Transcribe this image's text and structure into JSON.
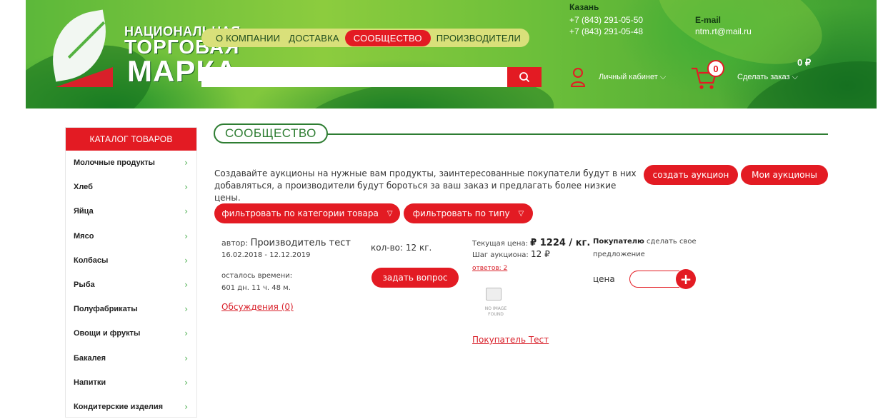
{
  "header": {
    "logo": {
      "line1": "НАЦИОНАЛЬНАЯ",
      "line2": "ТОРГОВАЯ",
      "line3": "МАРКА"
    },
    "nav": [
      "О КОМПАНИИ",
      "ДОСТАВКА",
      "СООБЩЕСТВО",
      "ПРОИЗВОДИТЕЛИ"
    ],
    "nav_active": "СООБЩЕСТВО",
    "search_placeholder": "",
    "city": "Казань",
    "phones": [
      "+7 (843) 291-05-50",
      "+7 (843) 291-05-48"
    ],
    "email_label": "E-mail",
    "email": "ntm.rt@mail.ru",
    "cabinet_label": "Личный кабинет",
    "cart_count": "0",
    "cart_sum": "0 ₽",
    "order_label": "Сделать заказ"
  },
  "sidebar": {
    "title": "КАТАЛОГ ТОВАРОВ",
    "items": [
      "Молочные продукты",
      "Хлеб",
      "Яйца",
      "Мясо",
      "Колбасы",
      "Рыба",
      "Полуфабрикаты",
      "Овощи и фрукты",
      "Бакалея",
      "Напитки",
      "Кондитерские изделия"
    ]
  },
  "main": {
    "title": "СООБЩЕСТВО",
    "description": "Создавайте аукционы на нужные вам продукты, заинтересованные покупатели будут в них добавляться, а производители будут бороться за ваш заказ и предлагать более низкие цены.",
    "create_auction": "создать аукцион",
    "my_auctions": "Мои аукционы",
    "filter_category": "фильтровать по категории товара",
    "filter_type": "фильтровать по типу",
    "lot": {
      "author_prefix": "автор:",
      "author": "Производитель тест",
      "dates": "16.02.2018 - 12.12.2019",
      "time_left_label": "осталось времени:",
      "time_left": "601 дн. 11 ч. 48 м.",
      "discussions": "Обсуждения (0)",
      "quantity": "кол-во: 12 кг.",
      "ask_question": "задать вопрос",
      "current_price_label": "Текущая цена:",
      "current_price": "₽ 1224 / кг.",
      "step_label": "Шаг аукциона:",
      "step": "12 ₽",
      "answers": "ответов: 2",
      "noimage_text": "NO IMAGE FOUND",
      "buyer": "Покупатель Тест",
      "offer_bold": "Покупателю",
      "offer_rest": "сделать свое",
      "offer_line2": "предложение",
      "price_label": "цена"
    }
  },
  "colors": {
    "accent": "#e31b23",
    "brand_green": "#2e7d32"
  }
}
